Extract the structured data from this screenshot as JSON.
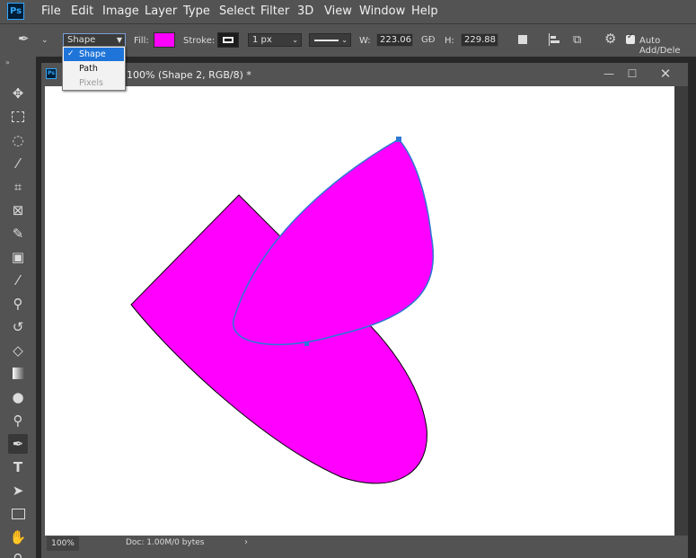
{
  "app": {
    "logo_text": "Ps"
  },
  "menu": [
    "File",
    "Edit",
    "Image",
    "Layer",
    "Type",
    "Select",
    "Filter",
    "3D",
    "View",
    "Window",
    "Help"
  ],
  "options_bar": {
    "tool_mode": "Shape",
    "fill_label": "Fill:",
    "fill_color": "#ff00ff",
    "stroke_label": "Stroke:",
    "stroke_width": "1 px",
    "width_label": "W:",
    "width_value": "223.06 p",
    "link_icon": "GĐ",
    "height_label": "H:",
    "height_value": "229.88 p",
    "auto_add_delete_label": "Auto Add/Dele"
  },
  "mode_dropdown": {
    "items": [
      {
        "label": "Shape",
        "selected": true,
        "check": "✓"
      },
      {
        "label": "Path",
        "selected": false
      },
      {
        "label": "Pixels",
        "selected": false,
        "disabled": true
      }
    ]
  },
  "tools": [
    "move-tool",
    "marquee-tool",
    "lasso-tool",
    "magic-wand-tool",
    "crop-tool",
    "frame-tool",
    "eyedropper-tool",
    "healing-brush-tool",
    "brush-tool",
    "clone-stamp-tool",
    "history-brush-tool",
    "eraser-tool",
    "gradient-tool",
    "blur-tool",
    "dodge-tool",
    "pen-tool",
    "type-tool",
    "path-selection-tool",
    "rectangle-tool",
    "hand-tool",
    "zoom-tool"
  ],
  "document": {
    "title": "100% (Shape 2, RGB/8) *",
    "zoom": "100%",
    "doc_info": "Doc: 1.00M/0 bytes",
    "shape_fill": "#ff00ff",
    "shape_stroke": "#000000",
    "path_color": "#2d7ad6"
  }
}
